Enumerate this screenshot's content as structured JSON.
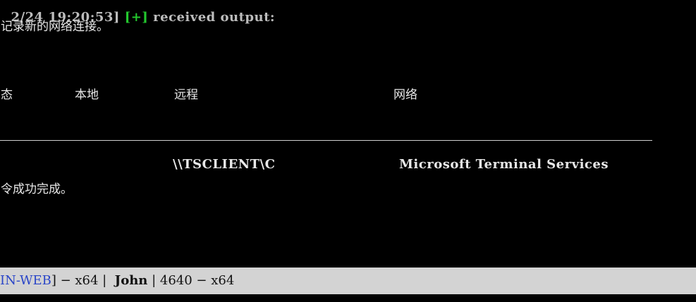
{
  "terminal": {
    "top_line": {
      "prefix": "2/24 19:20:53] ",
      "plus": "[+]",
      "message": " received output:"
    },
    "note_line": "记录新的网络连接。",
    "headers": {
      "status": "态",
      "local": "本地",
      "remote": "远程",
      "network": "网络"
    },
    "row": {
      "remote": "\\\\TSCLIENT\\C",
      "network": "Microsoft Terminal Services"
    },
    "done_line": "令成功完成。"
  },
  "statusbar": {
    "host_suffix": "IN-WEB",
    "tail1": "] − x64 |  ",
    "user": "John",
    "sep": " | ",
    "pid_arch": "4640 − x64"
  }
}
